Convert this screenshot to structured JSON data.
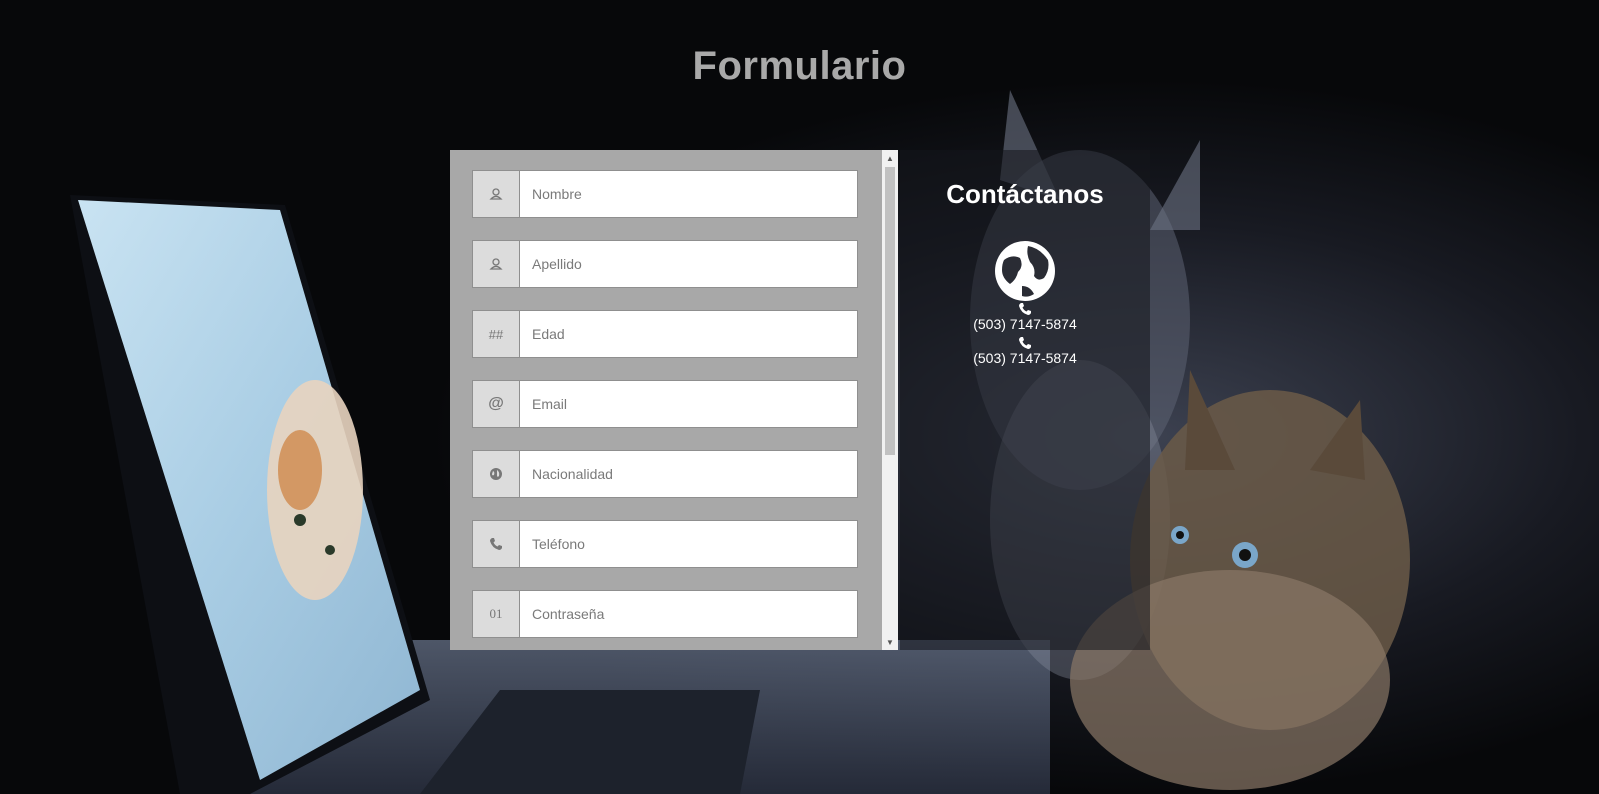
{
  "page": {
    "title": "Formulario"
  },
  "form": {
    "fields": [
      {
        "placeholder": "Nombre",
        "icon": "user-icon"
      },
      {
        "placeholder": "Apellido",
        "icon": "user-icon"
      },
      {
        "placeholder": "Edad",
        "icon": "hash-icon",
        "icon_text": "##"
      },
      {
        "placeholder": "Email",
        "icon": "at-icon",
        "icon_text": "@"
      },
      {
        "placeholder": "Nacionalidad",
        "icon": "globe-icon"
      },
      {
        "placeholder": "Teléfono",
        "icon": "phone-icon"
      },
      {
        "placeholder": "Contraseña",
        "icon": "binary-icon",
        "icon_text": "01"
      }
    ]
  },
  "contact": {
    "title": "Contáctanos",
    "phones": [
      "(503) 7147-5874",
      "(503) 7147-5874"
    ]
  },
  "colors": {
    "title": "#a9a9a9",
    "form_panel": "#a8a8a8",
    "contact_panel": "rgba(20,22,28,0.55)"
  }
}
